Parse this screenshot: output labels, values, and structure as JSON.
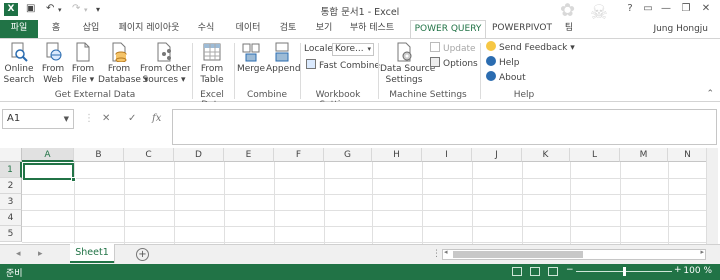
{
  "window": {
    "title": "통합 문서1 - Excel",
    "user": "Jung Hongju"
  },
  "tabs": [
    {
      "label": "파일"
    },
    {
      "label": "홈"
    },
    {
      "label": "삽입"
    },
    {
      "label": "페이지 레이아웃"
    },
    {
      "label": "수식"
    },
    {
      "label": "데이터"
    },
    {
      "label": "검토"
    },
    {
      "label": "보기"
    },
    {
      "label": "부하 테스트"
    },
    {
      "label": "POWER QUERY"
    },
    {
      "label": "POWERPIVOT"
    },
    {
      "label": "팀"
    }
  ],
  "ribbon": {
    "online_search": "Online\nSearch",
    "from_web": "From\nWeb",
    "from_file": "From\nFile ▾",
    "from_database": "From\nDatabase ▾",
    "from_other": "From Other\nSources ▾",
    "group_external": "Get External Data",
    "from_table": "From\nTable",
    "group_excel": "Excel Data",
    "merge": "Merge",
    "append": "Append",
    "group_combine": "Combine",
    "locale_label": "Locale:",
    "locale_value": "Kore...",
    "fast_combine": "Fast Combine",
    "group_workbook": "Workbook Settings",
    "data_source_settings": "Data Source\nSettings",
    "update": "Update",
    "options": "Options",
    "group_machine": "Machine Settings",
    "send_feedback": "Send Feedback ▾",
    "help": "Help",
    "about": "About",
    "group_help": "Help"
  },
  "formula_bar": {
    "name_box": "A1",
    "cancel": "✕",
    "enter": "✓",
    "fx": "fx",
    "formula": ""
  },
  "grid": {
    "columns": [
      "A",
      "B",
      "C",
      "D",
      "E",
      "F",
      "G",
      "H",
      "I",
      "J",
      "K",
      "L",
      "M",
      "N"
    ],
    "rows": [
      "1",
      "2",
      "3",
      "4",
      "5"
    ],
    "active_cell": "A1"
  },
  "sheets": {
    "tabs": [
      "Sheet1"
    ],
    "add": "+",
    "nav_prev": "◂",
    "nav_next": "▸",
    "more": "⋮"
  },
  "status": {
    "text": "준비",
    "zoom": "100 %",
    "zoom_minus": "−",
    "zoom_plus": "+"
  },
  "colors": {
    "accent": "#217346",
    "status_bar": "#217346"
  }
}
